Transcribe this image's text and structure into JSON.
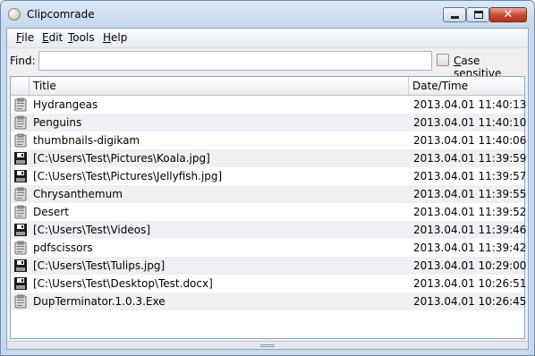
{
  "window": {
    "title": "Clipcomrade"
  },
  "titlebar_buttons": {
    "minimize": "",
    "maximize": "",
    "close": "✕"
  },
  "menu": {
    "file": {
      "key": "F",
      "rest": "ile"
    },
    "edit": {
      "key": "E",
      "rest": "dit"
    },
    "tools": {
      "key": "T",
      "rest": "ools"
    },
    "help": {
      "key": "H",
      "rest": "elp"
    }
  },
  "find": {
    "label": "Find:",
    "value": ""
  },
  "case_sensitive": {
    "key": "C",
    "rest": "ase sensitive",
    "checked": false
  },
  "table": {
    "columns": {
      "icon": "",
      "title": "Title",
      "date": "Date/Time"
    },
    "rows": [
      {
        "icon": "clipboard-icon",
        "title": "Hydrangeas",
        "date": "2013.04.01 11:40:13"
      },
      {
        "icon": "clipboard-icon",
        "title": "Penguins",
        "date": "2013.04.01 11:40:10"
      },
      {
        "icon": "clipboard-icon",
        "title": "thumbnails-digikam",
        "date": "2013.04.01 11:40:06"
      },
      {
        "icon": "floppy-icon",
        "title": "[C:\\Users\\Test\\Pictures\\Koala.jpg]",
        "date": "2013.04.01 11:39:59"
      },
      {
        "icon": "floppy-icon",
        "title": "[C:\\Users\\Test\\Pictures\\Jellyfish.jpg]",
        "date": "2013.04.01 11:39:57"
      },
      {
        "icon": "clipboard-icon",
        "title": "Chrysanthemum",
        "date": "2013.04.01 11:39:55"
      },
      {
        "icon": "clipboard-icon",
        "title": "Desert",
        "date": "2013.04.01 11:39:52"
      },
      {
        "icon": "floppy-icon",
        "title": "[C:\\Users\\Test\\Videos]",
        "date": "2013.04.01 11:39:46"
      },
      {
        "icon": "clipboard-icon",
        "title": "pdfscissors",
        "date": "2013.04.01 11:39:42"
      },
      {
        "icon": "floppy-icon",
        "title": "[C:\\Users\\Test\\Tulips.jpg]",
        "date": "2013.04.01 10:29:00"
      },
      {
        "icon": "floppy-icon",
        "title": "[C:\\Users\\Test\\Desktop\\Test.docx]",
        "date": "2013.04.01 10:26:51"
      },
      {
        "icon": "clipboard-icon",
        "title": "DupTerminator.1.0.3.Exe",
        "date": "2013.04.01 10:26:45"
      }
    ]
  },
  "colors": {
    "frame": "#c9d9ec",
    "row_alt": "#eef0f3",
    "close_button": "#c8472f"
  }
}
